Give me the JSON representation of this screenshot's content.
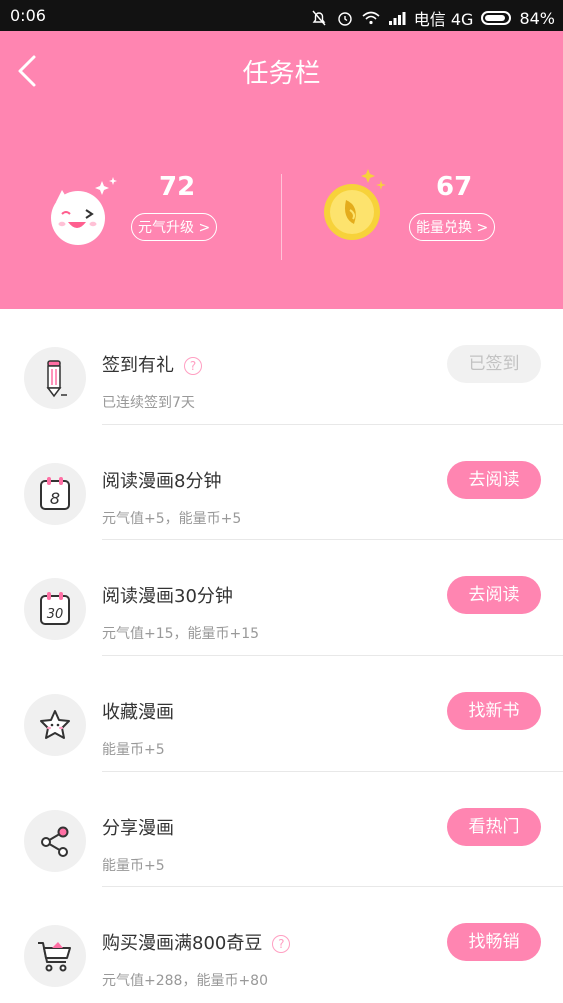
{
  "status_bar": {
    "time": "0:06",
    "carrier": "电信 4G",
    "battery": "84%"
  },
  "header": {
    "title": "任务栏",
    "left_stat": {
      "value": "72",
      "label": "元气升级 >"
    },
    "right_stat": {
      "value": "67",
      "label": "能量兑换 >"
    }
  },
  "tasks": [
    {
      "title": "签到有礼",
      "subtitle": "已连续签到7天",
      "button": "已签到",
      "icon": "pencil-icon",
      "has_help": true,
      "done": true
    },
    {
      "title": "阅读漫画8分钟",
      "subtitle": "元气值+5，能量币+5",
      "button": "去阅读",
      "icon": "calendar-8-icon",
      "has_help": false,
      "done": false
    },
    {
      "title": "阅读漫画30分钟",
      "subtitle": "元气值+15，能量币+15",
      "button": "去阅读",
      "icon": "calendar-30-icon",
      "has_help": false,
      "done": false
    },
    {
      "title": "收藏漫画",
      "subtitle": "能量币+5",
      "button": "找新书",
      "icon": "star-icon",
      "has_help": false,
      "done": false
    },
    {
      "title": "分享漫画",
      "subtitle": "能量币+5",
      "button": "看热门",
      "icon": "share-icon",
      "has_help": false,
      "done": false
    },
    {
      "title": "购买漫画满800奇豆",
      "subtitle": "元气值+288，能量币+80",
      "button": "找畅销",
      "icon": "cart-icon",
      "has_help": true,
      "done": false
    }
  ],
  "colors": {
    "brand_pink": "#ff85b1",
    "status_bar": "#121212",
    "button_done_bg": "#f1f1f1",
    "coin_yellow": "#f7d23a"
  }
}
